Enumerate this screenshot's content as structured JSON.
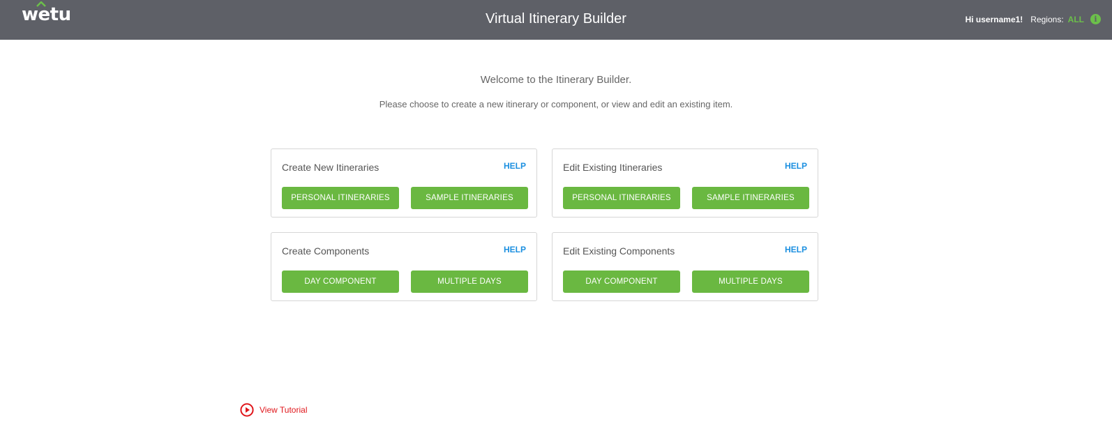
{
  "header": {
    "logo_text": "wetu",
    "title": "Virtual Itinerary Builder",
    "greeting": "Hi username1!",
    "regions_label": "Regions:",
    "regions_value": "ALL",
    "info_icon_glyph": "i"
  },
  "intro": {
    "welcome": "Welcome to the Itinerary Builder.",
    "instructions": "Please choose to create a new itinerary or component, or view and edit an existing item."
  },
  "cards": [
    {
      "title": "Create New Itineraries",
      "help": "HELP",
      "buttons": [
        "PERSONAL ITINERARIES",
        "SAMPLE ITINERARIES"
      ]
    },
    {
      "title": "Edit Existing Itineraries",
      "help": "HELP",
      "buttons": [
        "PERSONAL ITINERARIES",
        "SAMPLE ITINERARIES"
      ]
    },
    {
      "title": "Create Components",
      "help": "HELP",
      "buttons": [
        "DAY COMPONENT",
        "MULTIPLE DAYS"
      ]
    },
    {
      "title": "Edit Existing Components",
      "help": "HELP",
      "buttons": [
        "DAY COMPONENT",
        "MULTIPLE DAYS"
      ]
    }
  ],
  "tutorial": {
    "label": "View Tutorial",
    "icon": "play-circle-icon"
  },
  "colors": {
    "header_bg": "#5e6067",
    "accent_green": "#6ab841",
    "help_blue": "#1b8fe0",
    "tutorial_red": "#e0161b"
  }
}
